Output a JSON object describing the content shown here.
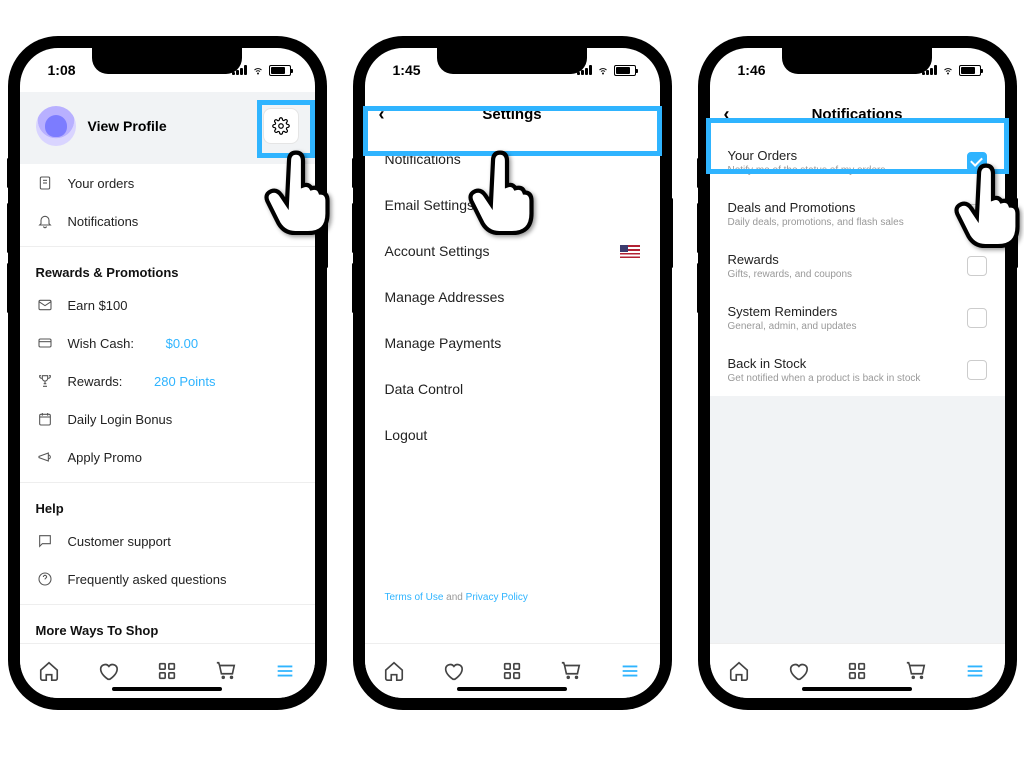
{
  "phone1": {
    "time": "1:08",
    "profile_label": "View Profile",
    "items": [
      {
        "icon": "receipt",
        "label": "Your orders"
      },
      {
        "icon": "bell",
        "label": "Notifications"
      }
    ],
    "rewards_header": "Rewards & Promotions",
    "rewards": [
      {
        "icon": "mail",
        "label": "Earn $100"
      },
      {
        "icon": "card",
        "label": "Wish Cash:",
        "val": "$0.00"
      },
      {
        "icon": "trophy",
        "label": "Rewards:",
        "val": "280 Points"
      },
      {
        "icon": "calendar",
        "label": "Daily Login Bonus"
      },
      {
        "icon": "mega",
        "label": "Apply Promo"
      }
    ],
    "help_header": "Help",
    "help": [
      {
        "icon": "chat",
        "label": "Customer support"
      },
      {
        "icon": "q",
        "label": "Frequently asked questions"
      }
    ],
    "more_header": "More Ways To Shop"
  },
  "phone2": {
    "time": "1:45",
    "title": "Settings",
    "items": [
      "Notifications",
      "Email Settings",
      "Account Settings",
      "Manage Addresses",
      "Manage Payments",
      "Data Control",
      "Logout"
    ],
    "footer_terms": "Terms of Use",
    "footer_and": " and ",
    "footer_privacy": "Privacy Policy"
  },
  "phone3": {
    "time": "1:46",
    "title": "Notifications",
    "items": [
      {
        "t": "Your Orders",
        "s": "Notify me of the status of my orders",
        "on": true
      },
      {
        "t": "Deals and Promotions",
        "s": "Daily deals, promotions, and flash sales",
        "on": false
      },
      {
        "t": "Rewards",
        "s": "Gifts, rewards, and coupons",
        "on": false
      },
      {
        "t": "System Reminders",
        "s": "General, admin, and updates",
        "on": false
      },
      {
        "t": "Back in Stock",
        "s": "Get notified when a product is back in stock",
        "on": false
      }
    ]
  }
}
